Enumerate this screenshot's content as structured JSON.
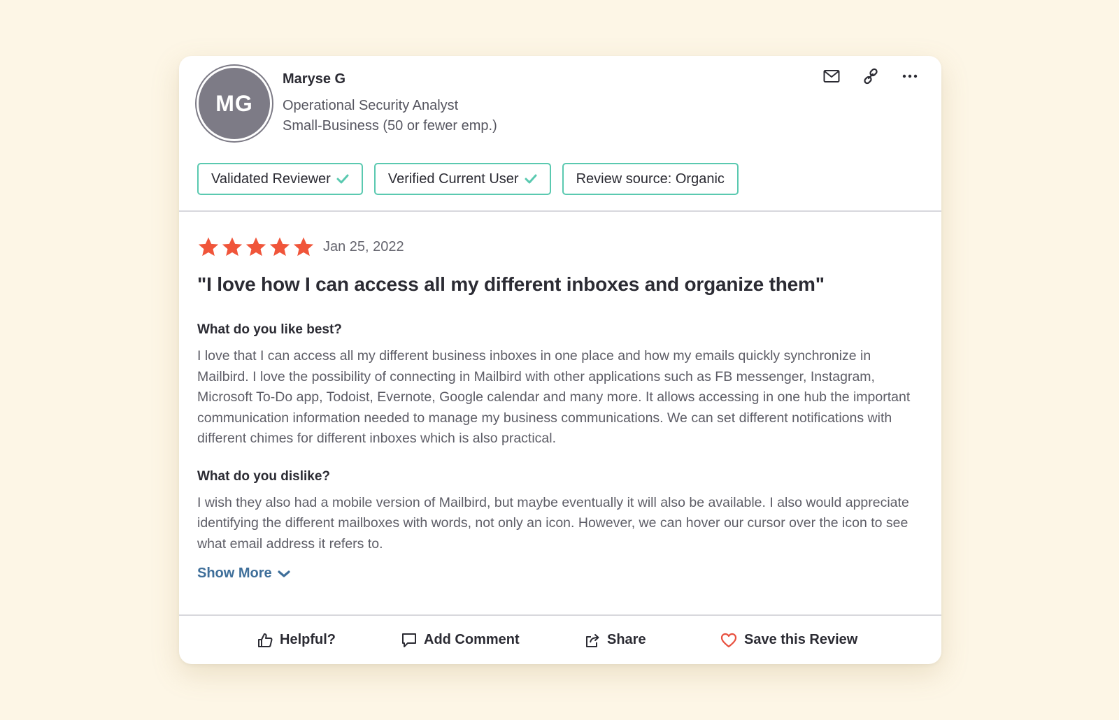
{
  "reviewer": {
    "initials": "MG",
    "name": "Maryse G",
    "role": "Operational Security Analyst",
    "company_size": "Small-Business (50 or fewer emp.)"
  },
  "header_actions": [
    {
      "icon": "mail-icon"
    },
    {
      "icon": "link-icon"
    },
    {
      "icon": "more-icon"
    }
  ],
  "badges": [
    {
      "label": "Validated Reviewer",
      "check": true
    },
    {
      "label": "Verified Current User",
      "check": true
    },
    {
      "label": "Review source: Organic",
      "check": false
    }
  ],
  "review": {
    "rating": 5,
    "rating_max": 5,
    "date": "Jan 25, 2022",
    "title": "\"I love how I can access all my different inboxes and organize them\"",
    "q1": "What do you like best?",
    "a1": "I love that I can access all my different business inboxes in one place and how my emails quickly synchronize in Mailbird. I love the possibility of connecting in Mailbird with other applications such as FB messenger, Instagram, Microsoft To-Do app, Todoist, Evernote, Google calendar and many more. It allows accessing in one hub the important communication information needed to manage my business communications. We can set different notifications with different chimes for different inboxes which is also practical.",
    "q2": "What do you dislike?",
    "a2": "I wish they also had a mobile version of Mailbird, but maybe eventually it will also be available. I also would appreciate identifying the different mailboxes with words, not only an icon. However, we can hover our cursor over the icon to see what email address it refers to.",
    "show_more": "Show More"
  },
  "footer": {
    "helpful": "Helpful?",
    "add_comment": "Add Comment",
    "share": "Share",
    "save": "Save this Review"
  },
  "colors": {
    "star": "#f0553a",
    "badge_border": "#5ac9b0",
    "link": "#3f6f9a",
    "heart": "#e8503f",
    "background": "#fdf6e6"
  }
}
